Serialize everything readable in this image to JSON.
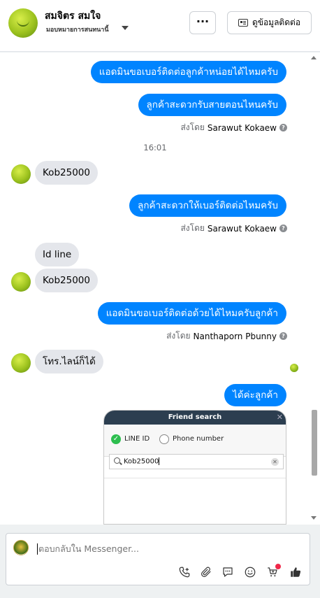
{
  "header": {
    "name": "สมจิตร สมใจ",
    "subtitle": "มอบหมายการสนทนานี้",
    "more_label": "···",
    "info_label": "ดูข้อมูลติดต่อ"
  },
  "messages": {
    "m1": "แอดมินขอเบอร์ติดต่อลูกค้าหน่อยได้ไหมครับ",
    "m2": "ลูกค้าสะดวกรับสายตอนไหนครับ",
    "m2_sent_prefix": "ส่งโดย",
    "m2_sent_by": "Sarawut Kokaew",
    "time1": "16:01",
    "m3": "Kob25000",
    "m4": "ลูกค้าสะดวกให้เบอร์ติดต่อไหมครับ",
    "m4_sent_prefix": "ส่งโดย",
    "m4_sent_by": "Sarawut Kokaew",
    "m5": "Id line",
    "m6": "Kob25000",
    "m7": "แอดมินขอเบอร์ติดต่อด้วยได้ไหมครับลูกค้า",
    "m7_sent_prefix": "ส่งโดย",
    "m7_sent_by": "Nanthaporn Pbunny",
    "m8": "โทร.ไลน์ก็ได้",
    "m9": "ได้ค่ะลูกค้า"
  },
  "friend_search": {
    "title": "Friend search",
    "close": "✕",
    "option_line_id": "LINE ID",
    "option_phone": "Phone number",
    "query": "Kob25000"
  },
  "composer": {
    "placeholder": "ตอบกลับใน Messenger..."
  },
  "colors": {
    "outgoing_bubble": "#0084ff",
    "incoming_bubble": "#e4e6eb",
    "like": "#0084ff"
  },
  "icons": [
    "add-call-icon",
    "attachment-icon",
    "saved-reply-icon",
    "emoji-icon",
    "cart-icon",
    "like-icon"
  ]
}
